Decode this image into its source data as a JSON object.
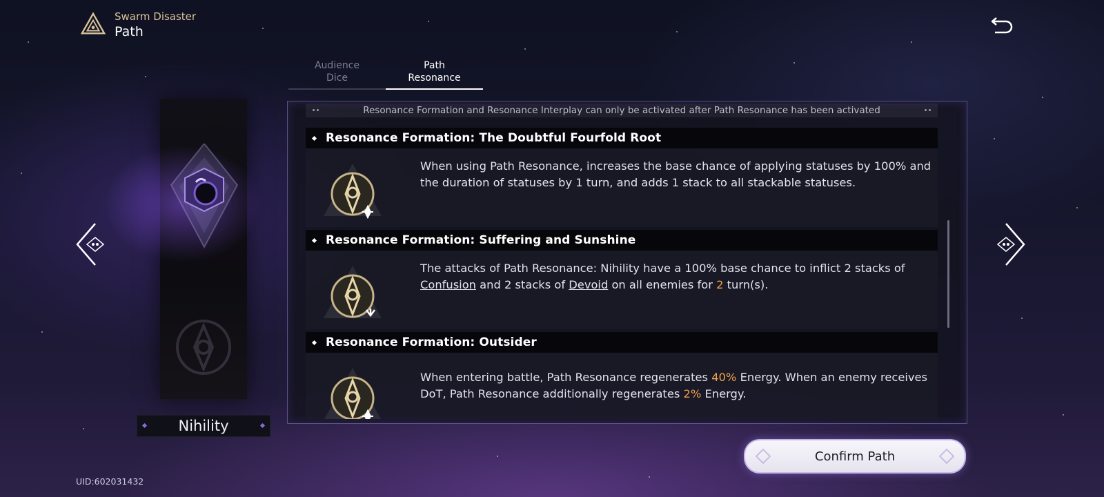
{
  "header": {
    "subtitle": "Swarm Disaster",
    "title": "Path",
    "logo_icon": "triangle-emblem-icon",
    "back_icon": "return-arrow-icon"
  },
  "tabs": [
    {
      "label": "Audience\nDice",
      "active": false
    },
    {
      "label": "Path\nResonance",
      "active": true
    }
  ],
  "path": {
    "name": "Nihility",
    "emblem_icon": "nihility-emblem-icon"
  },
  "notice": "Resonance Formation and Resonance Interplay can only be activated after Path Resonance has been activated",
  "entries": [
    {
      "title": "Resonance Formation: The Doubtful Fourfold Root",
      "desc": "When using Path Resonance, increases the base chance of applying statuses by 100% and the duration of statuses by 1 turn, and adds 1 stack to all stackable statuses."
    },
    {
      "title": "Resonance Formation: Suffering and Sunshine",
      "desc_parts": {
        "p1": "The attacks of Path Resonance: Nihility have a 100% base chance to inflict 2 stacks of ",
        "k1": "Confusion",
        "p2": " and 2 stacks of ",
        "k2": "Devoid",
        "p3": " on all enemies for ",
        "h1": "2",
        "p4": " turn(s)."
      }
    },
    {
      "title": "Resonance Formation: Outsider",
      "desc_parts": {
        "p1": "When entering battle, Path Resonance regenerates ",
        "h1": "40%",
        "p2": " Energy. When an enemy receives DoT, Path Resonance additionally regenerates ",
        "h2": "2%",
        "p3": " Energy."
      }
    }
  ],
  "confirm_label": "Confirm Path",
  "uid": "UID:602031432",
  "colors": {
    "accent_gold": "#d9c39a",
    "highlight_orange": "#f0a24a",
    "nihility_purple": "#8a6ad8"
  }
}
